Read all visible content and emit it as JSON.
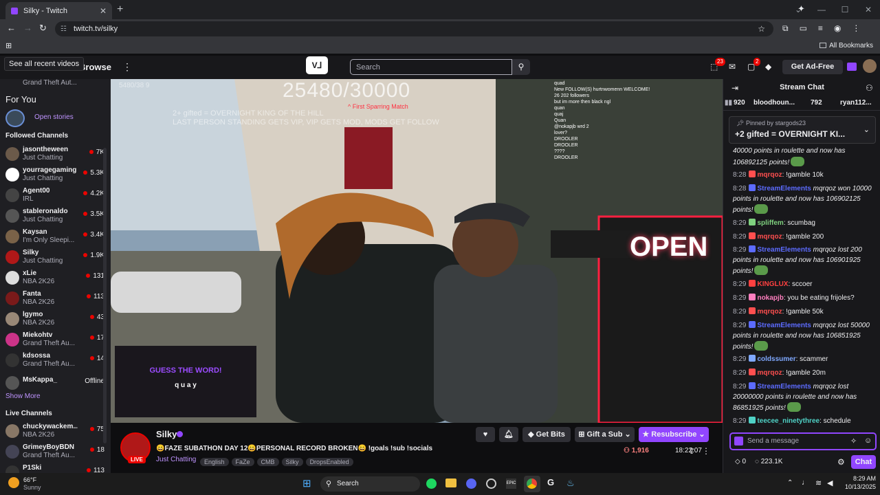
{
  "browser": {
    "tab_title": "Silky - Twitch",
    "new_tab": "+",
    "url": "twitch.tv/silky",
    "all_bookmarks": "All Bookmarks"
  },
  "topnav": {
    "tooltip": "See all recent videos",
    "browse": "Browse",
    "search_placeholder": "Search",
    "inbox_badge": "23",
    "notif_badge": "2",
    "get_ad_free": "Get Ad-Free"
  },
  "sidebar": {
    "top_item": {
      "name": "Grand Theft Aut..."
    },
    "for_you": "For You",
    "open_stories": "Open stories",
    "followed_header": "Followed Channels",
    "followed": [
      {
        "name": "jasontheween",
        "game": "Just Chatting",
        "count": "7K",
        "color": "#6b5a4a"
      },
      {
        "name": "yourragegaming",
        "game": "Just Chatting",
        "count": "5.3K",
        "color": "#ffffff"
      },
      {
        "name": "Agent00",
        "game": "IRL",
        "count": "4.2K",
        "color": "#444"
      },
      {
        "name": "stableronaldo",
        "game": "Just Chatting",
        "count": "3.5K",
        "color": "#555"
      },
      {
        "name": "Kaysan",
        "game": "I'm Only Sleepi...",
        "count": "3.4K",
        "color": "#7a6248"
      },
      {
        "name": "Silky",
        "game": "Just Chatting",
        "count": "1.9K",
        "color": "#b01818"
      },
      {
        "name": "xLie",
        "game": "NBA 2K26",
        "count": "131",
        "color": "#ddd"
      },
      {
        "name": "Fanta",
        "game": "NBA 2K26",
        "count": "113",
        "color": "#7a1a1a"
      },
      {
        "name": "lgymo",
        "game": "NBA 2K26",
        "count": "43",
        "color": "#998877"
      },
      {
        "name": "Miekohtv",
        "game": "Grand Theft Au...",
        "count": "17",
        "color": "#cc3388"
      },
      {
        "name": "kdsossa",
        "game": "Grand Theft Au...",
        "count": "14",
        "color": "#333"
      }
    ],
    "offline": {
      "name": "MsKappa_",
      "status": "Offline"
    },
    "show_more": "Show More",
    "live_header": "Live Channels",
    "live": [
      {
        "name": "chuckywackem...",
        "game": "NBA 2K26",
        "count": "75",
        "color": "#887766"
      },
      {
        "name": "GrimeyBoyBDN",
        "game": "Grand Theft Au...",
        "count": "18",
        "color": "#445"
      },
      {
        "name": "P1Ski",
        "game": "",
        "count": "113",
        "color": "#333"
      }
    ]
  },
  "video": {
    "goal_counter": "25480/30000",
    "first_sparring": "^ First Sparring Match",
    "overlay_line1": "2+ gifted = OVERNIGHT KING OF THE HILL",
    "overlay_line2": "LAST PERSON STANDING GETS VIP, VIP GETS MOD, MODS GET FOLLOW",
    "top_left_counter": "5480/38 9",
    "guess_title": "GUESS THE WORD!",
    "guess_letters": "q u a y",
    "store_sign": "OPEN",
    "mini_chat": [
      "quad",
      "New FOLLOW(S) hurtnwomenn WELCOME!",
      "26 202 followers",
      "but im more then black ngl",
      "quan",
      "quaj",
      "Quan",
      "@nokapjb wrd 2",
      "lover?",
      "DROOLER",
      "DROOLER",
      "????",
      "DROOLER"
    ]
  },
  "stream": {
    "name": "Silky",
    "live_badge": "LIVE",
    "title": "😄FAZE SUBATHON DAY 12😄PERSONAL RECORD BROKEN😄 !goals !sub !socials",
    "category": "Just Chatting",
    "tags": [
      "English",
      "FaZe",
      "CMB",
      "Silky",
      "DropsEnabled"
    ],
    "viewers": "1,916",
    "uptime": "18:22:07",
    "get_bits": "Get Bits",
    "gift_sub": "Gift a Sub",
    "resubscribe": "Resubscribe"
  },
  "chat": {
    "title": "Stream Chat",
    "leaderboard": [
      {
        "rank": "920",
        "name": "bloodhoun..."
      },
      {
        "rank": "792",
        "name": "ryan112..."
      }
    ],
    "pinned_by": "Pinned by",
    "pinned_user": "stargods23",
    "pinned_text": "+2 gifted = OVERNIGHT KI...",
    "partial_top": "106892125 points!",
    "messages": [
      {
        "ts": "",
        "user": "",
        "color": "#efeff1",
        "text": "40000 points in roulette and now has 106892125 points!",
        "italic": true,
        "emote": true
      },
      {
        "ts": "8:28",
        "user": "mqrqoz",
        "color": "#ff4f4f",
        "text": "!gamble 10k"
      },
      {
        "ts": "8:28",
        "user": "StreamElements",
        "color": "#5c6bff",
        "text": "mqrqoz won 10000 points in roulette and now has 106902125 points!",
        "italic": true,
        "emote": true
      },
      {
        "ts": "8:29",
        "user": "spliffem",
        "color": "#7fd17f",
        "text": "scumbag"
      },
      {
        "ts": "8:29",
        "user": "mqrqoz",
        "color": "#ff4f4f",
        "text": "!gamble 200"
      },
      {
        "ts": "8:29",
        "user": "StreamElements",
        "color": "#5c6bff",
        "text": "mqrqoz lost 200 points in roulette and now has 106901925 points!",
        "italic": true,
        "emote": true
      },
      {
        "ts": "8:29",
        "user": "KINGLUX",
        "color": "#ff4040",
        "text": "sccoer"
      },
      {
        "ts": "8:29",
        "user": "nokapjb",
        "color": "#ff7fbf",
        "text": "you be eating frijoles?"
      },
      {
        "ts": "8:29",
        "user": "mqrqoz",
        "color": "#ff4f4f",
        "text": "!gamble 50k"
      },
      {
        "ts": "8:29",
        "user": "StreamElements",
        "color": "#5c6bff",
        "text": "mqrqoz lost 50000 points in roulette and now has 106851925 points!",
        "italic": true,
        "emote": true
      },
      {
        "ts": "8:29",
        "user": "coldssumer",
        "color": "#7fa8ff",
        "text": "scammer"
      },
      {
        "ts": "8:29",
        "user": "mqrqoz",
        "color": "#ff4f4f",
        "text": "!gamble 20m"
      },
      {
        "ts": "8:29",
        "user": "StreamElements",
        "color": "#5c6bff",
        "text": "mqrqoz lost 20000000 points in roulette and now has 86851925 points!",
        "italic": true,
        "emote": true
      },
      {
        "ts": "8:29",
        "user": "teecee_ninetythree",
        "color": "#4fd1c5",
        "text": "schedule"
      }
    ],
    "send_placeholder": "Send a message",
    "bits": "0",
    "points": "223.1K",
    "chat_button": "Chat"
  },
  "taskbar": {
    "weather_temp": "66°F",
    "weather_desc": "Sunny",
    "search": "Search",
    "time": "8:29 AM",
    "date": "10/13/2025"
  }
}
